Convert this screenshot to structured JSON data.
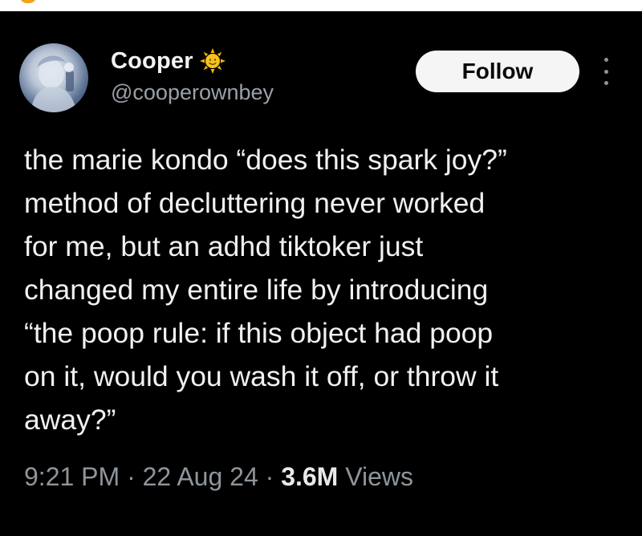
{
  "author": {
    "display_name": "Cooper",
    "handle": "@cooperownbey",
    "badge_icon": "sun-emoji-icon",
    "avatar_icon": "profile-photo-avatar"
  },
  "actions": {
    "follow_label": "Follow",
    "more_icon": "more-options-icon"
  },
  "tweet": {
    "text": "the marie kondo “does this spark joy?”\nmethod of decluttering never worked\nfor me, but an adhd tiktoker just\nchanged my entire life by introducing\n“the poop rule: if this object had poop\non it, would you wash it off, or throw it\naway?”"
  },
  "meta": {
    "time": "9:21 PM",
    "separator": " · ",
    "date": "22 Aug 24",
    "views_count": "3.6M",
    "views_label": " Views"
  },
  "colors": {
    "background": "#000000",
    "text": "#f1f1f1",
    "muted": "#9aa0a6",
    "follow_bg": "#f5f5f5",
    "badge": "#f4b400"
  }
}
